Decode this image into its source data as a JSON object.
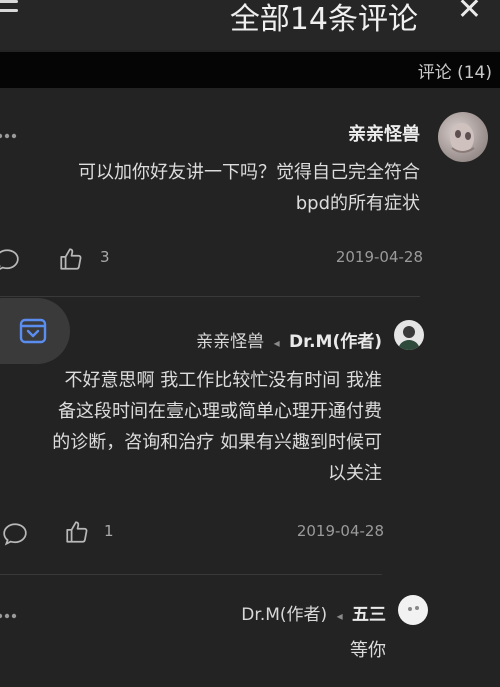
{
  "header": {
    "title": "全部14条评论",
    "menu_icon": "menu-icon",
    "close_icon": "close-icon"
  },
  "subbar": {
    "count_label": "评论 (14)"
  },
  "comments": [
    {
      "author": "亲亲怪兽",
      "body_lines": [
        "可以加你好友讲一下吗？觉得自己完全符合",
        "bpd的所有症状"
      ],
      "date": "2019-04-28",
      "likes": "3"
    },
    {
      "author": "Dr.M(作者)",
      "reply_to": "亲亲怪兽",
      "body_lines": [
        "不好意思啊 我工作比较忙没有时间 我准",
        "备这段时间在壹心理或简单心理开通付费",
        "的诊断，咨询和治疗 如果有兴趣到时候可",
        "以关注"
      ],
      "date": "2019-04-28",
      "likes": "1"
    },
    {
      "author": "五三",
      "reply_to": "Dr.M(作者)",
      "body_lines": [
        "等你"
      ]
    }
  ],
  "colors": {
    "background": "#232323",
    "header": "#262626",
    "subbar": "#050505",
    "accent": "#5b8df0"
  },
  "icons": [
    "menu-icon",
    "close-icon",
    "thumb-up-icon",
    "reply-icon",
    "more-icon",
    "inbox-icon"
  ]
}
